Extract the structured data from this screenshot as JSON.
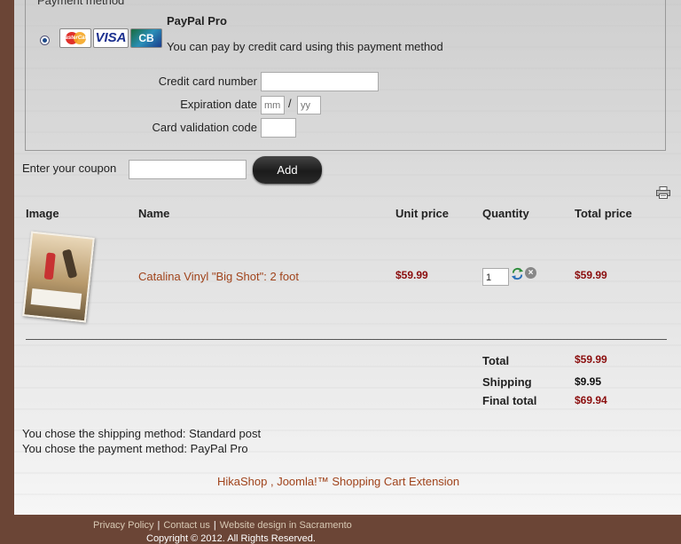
{
  "payment": {
    "legend": "Payment method",
    "method_title": "PayPal Pro",
    "method_desc": "You can pay by credit card using this payment method",
    "card_logos": {
      "mastercard": "MasterCard",
      "visa": "VISA",
      "cb": "CB"
    },
    "cc_number_label": "Credit card number",
    "cc_number_value": "",
    "expiration_label": "Expiration date",
    "exp_month_placeholder": "mm",
    "exp_year_placeholder": "yy",
    "exp_separator": "/",
    "cvc_label": "Card validation code",
    "cvc_value": ""
  },
  "coupon": {
    "label": "Enter your coupon",
    "value": "",
    "add_label": "Add"
  },
  "cart": {
    "print_icon": "print-icon",
    "headers": {
      "image": "Image",
      "name": "Name",
      "unit_price": "Unit price",
      "quantity": "Quantity",
      "total_price": "Total price"
    },
    "items": [
      {
        "name": "Catalina Vinyl \"Big Shot\": 2 foot",
        "unit_price": "$59.99",
        "quantity": "1",
        "total_price": "$59.99"
      }
    ],
    "totals": {
      "total_label": "Total",
      "total_value": "$59.99",
      "shipping_label": "Shipping",
      "shipping_value": "$9.95",
      "final_label": "Final total",
      "final_value": "$69.94"
    }
  },
  "summary": {
    "shipping_text": "You chose the shipping method: Standard post",
    "payment_text": "You chose the payment method: PayPal Pro"
  },
  "credit": "HikaShop , Joomla!™ Shopping Cart Extension",
  "footer": {
    "links": [
      "Privacy Policy",
      "Contact us",
      "Website design in Sacramento"
    ],
    "separator": "|",
    "copyright": "Copyright © 2012. All Rights Reserved."
  },
  "colors": {
    "accent": "#a0431b",
    "price": "#8b0e0e",
    "page_bg": "#6b4536"
  }
}
